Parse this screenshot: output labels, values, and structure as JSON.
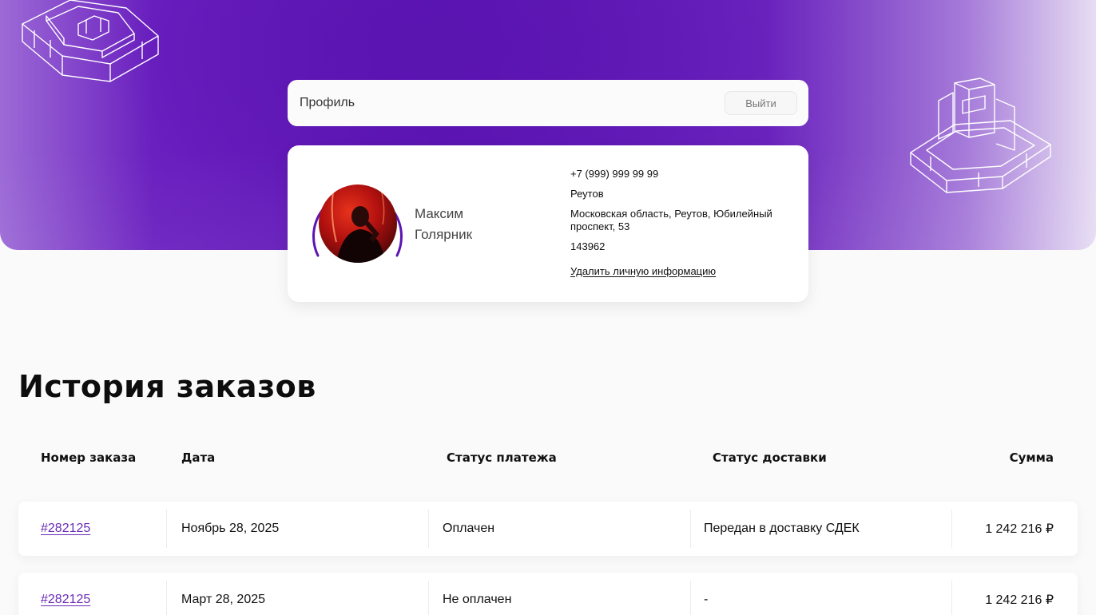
{
  "profile_bar": {
    "title": "Профиль",
    "logout_label": "Выйти"
  },
  "user": {
    "first_name": "Максим",
    "last_name": "Голярник",
    "phone": "+7 (999) 999 99 99",
    "city": "Реутов",
    "address": "Московская область, Реутов, Юбилейный проспект, 53",
    "postal_code": "143962",
    "delete_label": "Удалить личную информацию"
  },
  "history": {
    "title": "История заказов",
    "columns": [
      "Номер заказа",
      "Дата",
      "Статус платежа",
      "Статус доставки",
      "Сумма"
    ],
    "orders": [
      {
        "number": "#282125",
        "date": "Ноябрь 28, 2025",
        "payment": "Оплачен",
        "delivery": "Передан в доставку СДЕК",
        "sum": "1 242 216 ₽"
      },
      {
        "number": "#282125",
        "date": "Март 28, 2025",
        "payment": "Не оплачен",
        "delivery": "-",
        "sum": "1 242 216 ₽"
      }
    ]
  },
  "colors": {
    "accent": "#5c14b3",
    "link": "#6a2bb8"
  },
  "icons": [
    "keyboard-switch-illustration",
    "avatar-photo"
  ]
}
